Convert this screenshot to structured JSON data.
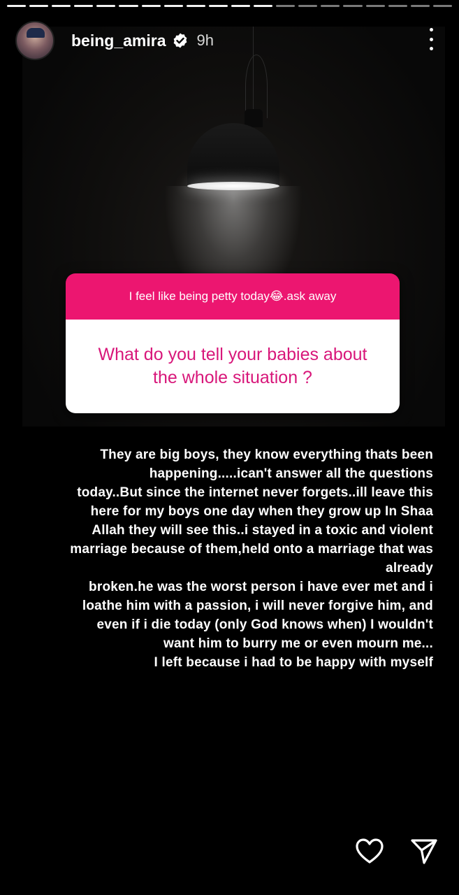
{
  "story": {
    "segments_seen": 12,
    "segments_total": 20,
    "username": "being_amira",
    "verified": true,
    "timestamp": "9h",
    "more_icon": "more-vertical-icon"
  },
  "question_sticker": {
    "prompt": "I feel like being petty today😂.ask away",
    "question": "What do you tell your babies about the whole situation ?",
    "accent_color": "#ec1670",
    "question_color": "#d8177a"
  },
  "caption_lines": [
    "They are big boys, they know everything thats been",
    "happening.....ican't answer all the questions",
    "today..But since the internet never forgets..ill leave this",
    "here for my boys one day when they grow up In Shaa",
    "Allah they will see this..i stayed in a toxic and violent",
    "marriage because of them,held onto a marriage that was",
    "already",
    "broken.he was the worst person i have ever met and i",
    "loathe him with a passion, i will never forgive him, and",
    "even if i die today (only God knows when) I wouldn't",
    "want him to burry me or even mourn me...",
    "I left because i had to be happy with myself"
  ],
  "actions": {
    "like_icon": "heart-icon",
    "share_icon": "send-icon"
  }
}
